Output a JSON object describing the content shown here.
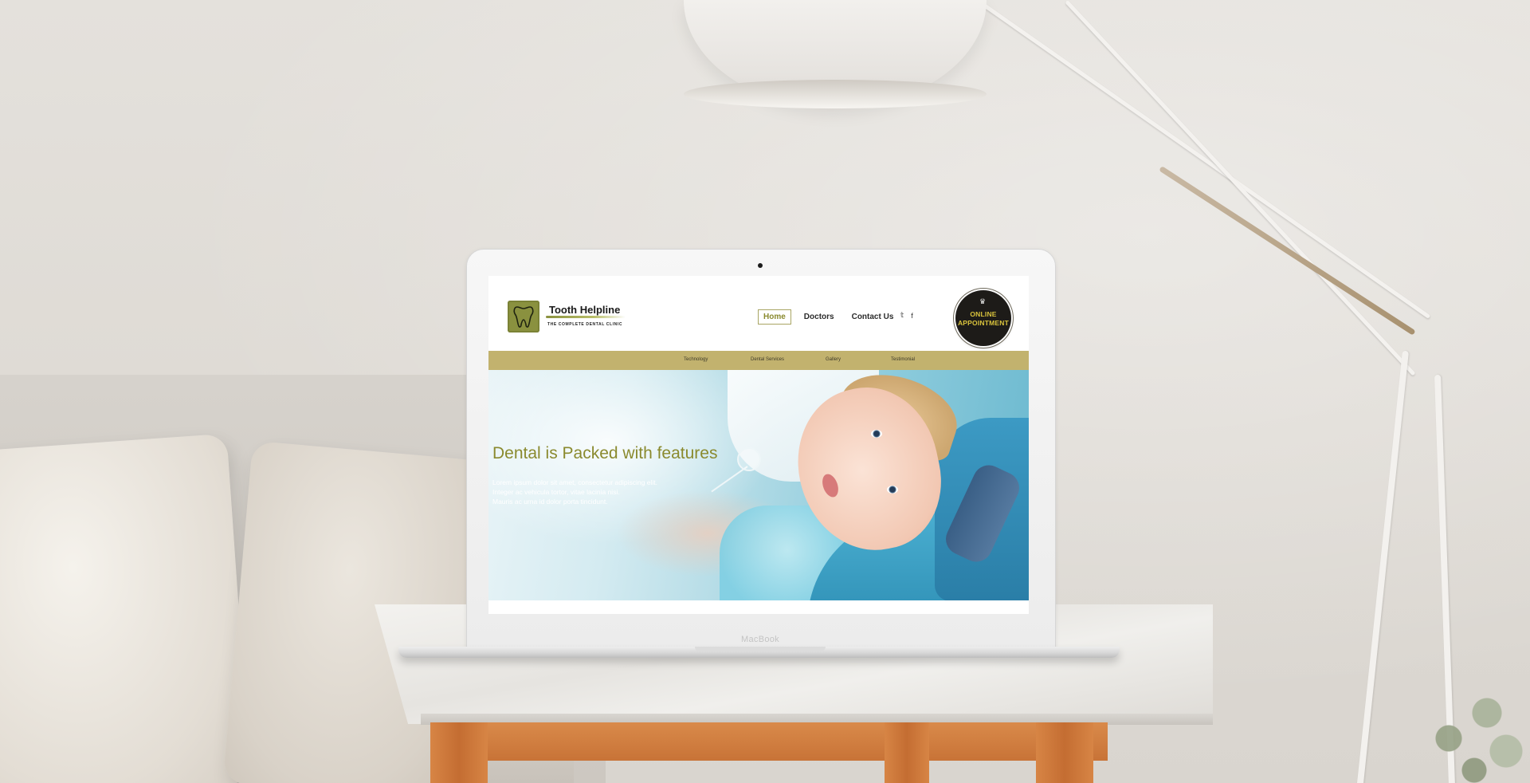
{
  "device": {
    "brand_label": "MacBook"
  },
  "site": {
    "logo": {
      "title": "Tooth Helpline",
      "tagline": "THE COMPLETE DENTAL CLINIC",
      "color": "#8a913f"
    },
    "main_nav": [
      {
        "label": "Home",
        "active": true
      },
      {
        "label": "Doctors",
        "active": false
      },
      {
        "label": "Contact Us",
        "active": false
      }
    ],
    "social": {
      "twitter_icon": "twitter-icon",
      "twitter_glyph": "𝕥",
      "facebook_icon": "facebook-icon",
      "facebook_glyph": "f"
    },
    "appointment_badge": {
      "line1": "ONLINE",
      "line2": "APPOINTMENT",
      "icon": "tooth-icon"
    },
    "sub_nav": [
      {
        "label": "Technology"
      },
      {
        "label": "Dental Services"
      },
      {
        "label": "Gallery"
      },
      {
        "label": "Testimonial"
      }
    ],
    "hero": {
      "title": "Dental is Packed with features",
      "lines": [
        "Lorem ipsum dolor sit amet, consectetur adipiscing elit.",
        "Integer ac vehicula tortor, vitae lacinia nisi.",
        "Mauris ac urna id dolor porta tincidunt."
      ]
    },
    "colors": {
      "accent": "#8a8a2e",
      "sub_nav_bg": "#c2b26e",
      "badge_bg": "#1d1b18",
      "badge_text": "#d9c33c"
    }
  }
}
